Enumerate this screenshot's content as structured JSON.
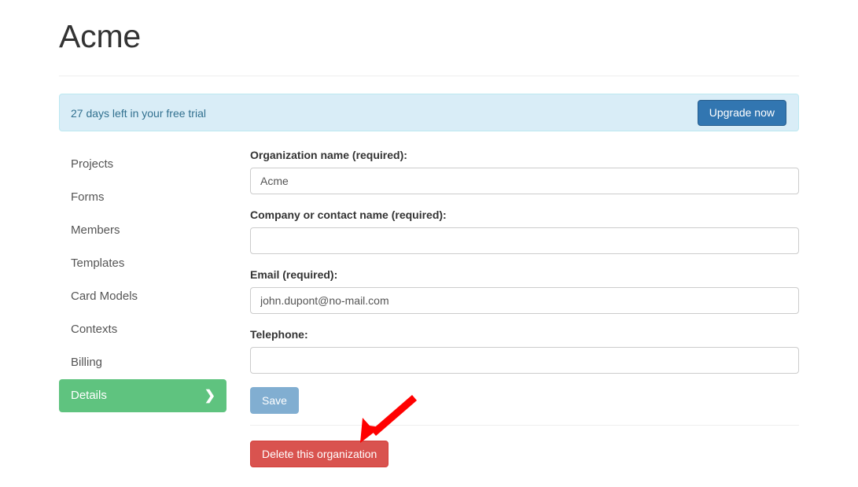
{
  "page": {
    "title": "Acme"
  },
  "alert": {
    "message": "27 days left in your free trial",
    "upgrade_label": "Upgrade now",
    "background_color": "#d9edf7",
    "border_color": "#bce8f1",
    "text_color": "#31708f"
  },
  "sidebar": {
    "items": [
      {
        "label": "Projects",
        "active": false
      },
      {
        "label": "Forms",
        "active": false
      },
      {
        "label": "Members",
        "active": false
      },
      {
        "label": "Templates",
        "active": false
      },
      {
        "label": "Card Models",
        "active": false
      },
      {
        "label": "Contexts",
        "active": false
      },
      {
        "label": "Billing",
        "active": false
      },
      {
        "label": "Details",
        "active": true
      }
    ],
    "active_color": "#5fc37f",
    "active_chevron": "❯"
  },
  "form": {
    "fields": [
      {
        "label": "Organization name (required):",
        "value": "Acme",
        "placeholder": ""
      },
      {
        "label": "Company or contact name (required):",
        "value": "",
        "placeholder": ""
      },
      {
        "label": "Email (required):",
        "value": "john.dupont@no-mail.com",
        "placeholder": ""
      },
      {
        "label": "Telephone:",
        "value": "",
        "placeholder": ""
      }
    ],
    "save_label": "Save",
    "save_color": "#81aed1"
  },
  "danger_zone": {
    "delete_label": "Delete this organization",
    "delete_color": "#d9534f"
  },
  "annotation": {
    "arrow_color": "#ff0000",
    "points_to": "delete-organization-button"
  }
}
